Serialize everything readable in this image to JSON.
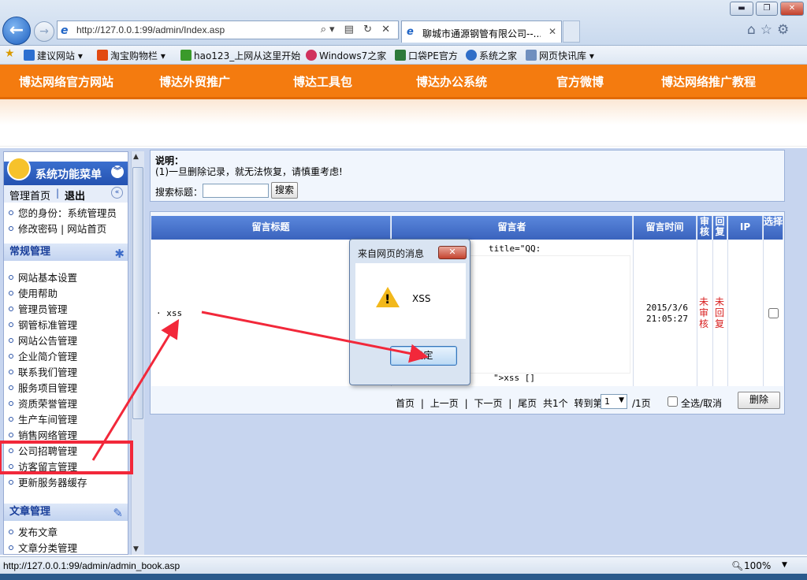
{
  "browser": {
    "address": "http://127.0.0.1:99/admin/Index.asp",
    "tab_title": "聊城市通源钢管有限公司--...",
    "favorites": [
      "建议网站",
      "淘宝购物栏",
      "hao123_上网从这里开始",
      "Windows7之家",
      "口袋PE官方",
      "系统之家",
      "网页快讯库"
    ],
    "status_url": "http://127.0.0.1:99/admin/admin_book.asp",
    "zoom": "100%"
  },
  "site_nav": [
    "博达网络官方网站",
    "博达外贸推广",
    "博达工具包",
    "博达办公系统",
    "官方微博",
    "博达网络推广教程"
  ],
  "left_menu": {
    "header": "系统功能菜单",
    "top_links": {
      "home": "管理首页",
      "sep": "|",
      "logout": "退出"
    },
    "identity": "您的身份：系统管理员",
    "change_pwd": "修改密码",
    "sep": "|",
    "site_home": "网站首页",
    "section1": "常规管理",
    "items": [
      "网站基本设置",
      "使用帮助",
      "管理员管理",
      "钢管标准管理",
      "网站公告管理",
      "企业简介管理",
      "联系我们管理",
      "服务项目管理",
      "资质荣誉管理",
      "生产车间管理",
      "销售网络管理",
      "公司招聘管理",
      "访客留言管理",
      "更新服务器缓存"
    ],
    "section2": "文章管理",
    "items2": [
      "发布文章",
      "文章分类管理"
    ]
  },
  "note": {
    "title": "说明：",
    "line1": "(1)一旦删除记录，就无法恢复，请慎重考虑!",
    "search_label": "搜索标题：",
    "search_value": "",
    "search_btn": "搜索"
  },
  "table": {
    "headers": {
      "title": "留言标题",
      "author": "留言者",
      "time": "留言时间",
      "audit": "审核",
      "reply": "回复",
      "ip": "IP",
      "select": "选择"
    },
    "row": {
      "title": "· xss",
      "author_top": "title=\"QQ:",
      "author_bottom": "\">xss []",
      "date": "2015/3/6",
      "clock": "21:05:27",
      "audit": "未审核",
      "reply": "未回复"
    },
    "pager": {
      "first": "首页",
      "prev": "上一页",
      "next": "下一页",
      "last": "尾页",
      "sep": "|",
      "total": "共1个",
      "goto": "转到第",
      "page": "1",
      "of": "/1页",
      "select_all": "全选/取消",
      "delete_btn": "删除"
    }
  },
  "dialog": {
    "title": "来自网页的消息",
    "message": "XSS",
    "ok": "确定"
  },
  "colors": {
    "orange": "#f47b0f",
    "blue_header": "#3a63bd",
    "annotation_red": "#f2283a"
  }
}
